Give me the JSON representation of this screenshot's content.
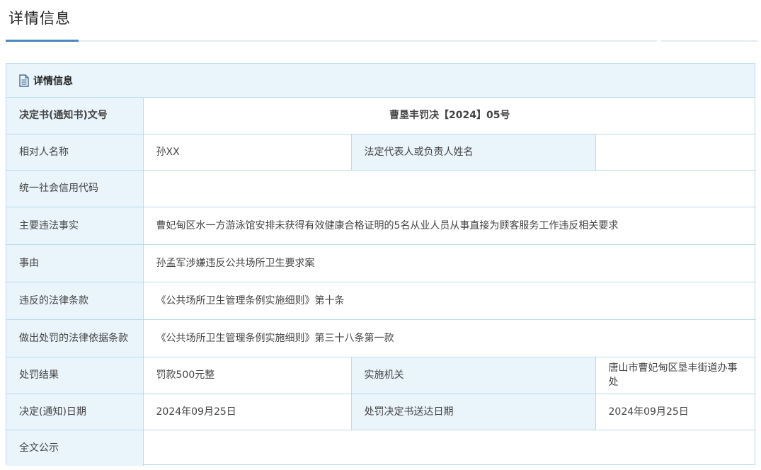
{
  "page": {
    "title": "详情信息"
  },
  "panel": {
    "title": "详情信息"
  },
  "rows": {
    "doc_no": {
      "label": "决定书(通知书)文号",
      "value": "曹垦丰罚决【2024】05号"
    },
    "party": {
      "label": "相对人名称",
      "value": "孙XX",
      "label2": "法定代表人或负责人姓名",
      "value2": ""
    },
    "credit_code": {
      "label": "统一社会信用代码",
      "value": ""
    },
    "facts": {
      "label": "主要违法事实",
      "value": "曹妃甸区水一方游泳馆安排未获得有效健康合格证明的5名从业人员从事直接为顾客服务工作违反相关要求"
    },
    "cause": {
      "label": "事由",
      "value": "孙孟军涉嫌违反公共场所卫生要求案"
    },
    "violated": {
      "label": "违反的法律条款",
      "value": "《公共场所卫生管理条例实施细则》第十条"
    },
    "basis": {
      "label": "做出处罚的法律依据条款",
      "value": "《公共场所卫生管理条例实施细则》第三十八条第一款"
    },
    "result": {
      "label": "处罚结果",
      "value": "罚款500元整",
      "label2": "实施机关",
      "value2": "唐山市曹妃甸区垦丰街道办事处"
    },
    "dates": {
      "label": "决定(通知)日期",
      "value": "2024年09月25日",
      "label2": "处罚决定书送达日期",
      "value2": "2024年09月25日"
    },
    "full_text": {
      "label": "全文公示",
      "value": ""
    }
  },
  "colors": {
    "accent": "#4a89bf",
    "label_bg": "#e9f4fb",
    "border": "#b9dcee"
  },
  "icons": {
    "panel_icon": "document-icon"
  }
}
